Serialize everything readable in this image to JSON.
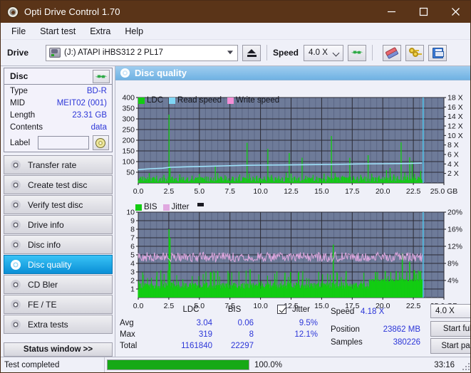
{
  "window": {
    "title": "Opti Drive Control 1.70",
    "icon": "disc-icon",
    "minimize": "minimize-icon",
    "maximize": "maximize-icon",
    "close": "close-icon"
  },
  "menu": {
    "items": [
      "File",
      "Start test",
      "Extra",
      "Help"
    ]
  },
  "toolbar": {
    "drive_label": "Drive",
    "drive_value": "(J:)  ATAPI iHBS312  2 PL17",
    "eject_icon": "eject-icon",
    "speed_label": "Speed",
    "speed_value": "4.0 X",
    "refresh_icon": "refresh-icon",
    "erase_icon": "eraser-icon",
    "keys_icon": "keys-icon",
    "save_icon": "floppy-save-icon"
  },
  "disc": {
    "title": "Disc",
    "refresh_icon": "refresh-icon",
    "rows": [
      {
        "key": "Type",
        "value": "BD-R"
      },
      {
        "key": "MID",
        "value": "MEIT02 (001)"
      },
      {
        "key": "Length",
        "value": "23.31 GB"
      },
      {
        "key": "Contents",
        "value": "data"
      }
    ],
    "label_key": "Label",
    "label_value": "",
    "label_placeholder": "",
    "cd_icon": "cd-icon"
  },
  "nav": {
    "items": [
      {
        "label": "Transfer rate",
        "icon": "disc-transfer-icon",
        "active": false
      },
      {
        "label": "Create test disc",
        "icon": "disc-create-icon",
        "active": false
      },
      {
        "label": "Verify test disc",
        "icon": "disc-verify-icon",
        "active": false
      },
      {
        "label": "Drive info",
        "icon": "disc-drive-icon",
        "active": false
      },
      {
        "label": "Disc info",
        "icon": "disc-info-icon",
        "active": false
      },
      {
        "label": "Disc quality",
        "icon": "disc-quality-icon",
        "active": true
      },
      {
        "label": "CD Bler",
        "icon": "disc-bler-icon",
        "active": false
      },
      {
        "label": "FE / TE",
        "icon": "disc-fete-icon",
        "active": false
      },
      {
        "label": "Extra tests",
        "icon": "disc-extra-icon",
        "active": false
      }
    ],
    "status_window": "Status window >>"
  },
  "panel": {
    "title": "Disc quality",
    "icon": "disc-quality-icon"
  },
  "chart_data": [
    {
      "type": "line",
      "name": "ldc-chart",
      "title": "",
      "xlabel": "GB",
      "ylabel": "",
      "xlim": [
        0,
        25
      ],
      "xticks": [
        "0.0",
        "2.5",
        "5.0",
        "7.5",
        "10.0",
        "12.5",
        "15.0",
        "17.5",
        "20.0",
        "22.5",
        "25.0 GB"
      ],
      "xtick_values": [
        0,
        2.5,
        5,
        7.5,
        10,
        12.5,
        15,
        17.5,
        20,
        22.5,
        25
      ],
      "ylim": [
        0,
        400
      ],
      "yticks": [
        "50",
        "100",
        "150",
        "200",
        "250",
        "300",
        "350",
        "400"
      ],
      "ytick_values": [
        50,
        100,
        150,
        200,
        250,
        300,
        350,
        400
      ],
      "y2lim": [
        0,
        18
      ],
      "y2ticks": [
        "2 X",
        "4 X",
        "6 X",
        "8 X",
        "10 X",
        "12 X",
        "14 X",
        "16 X",
        "18 X"
      ],
      "y2tick_values": [
        2,
        4,
        6,
        8,
        10,
        12,
        14,
        16,
        18
      ],
      "grid": true,
      "legend": [
        {
          "label": "LDC",
          "color": "#12cc12"
        },
        {
          "label": "Read speed",
          "color": "#7fd6f5"
        },
        {
          "label": "Write speed",
          "color": "#f58fd6"
        }
      ],
      "series": [
        {
          "name": "LDC",
          "color": "#12cc12",
          "style": "spikes",
          "baseline": 12,
          "spikes": [
            [
              0.35,
              30
            ],
            [
              0.6,
              22
            ],
            [
              0.9,
              46
            ],
            [
              1.2,
              26
            ],
            [
              1.5,
              34
            ],
            [
              1.8,
              20
            ],
            [
              2.1,
              38
            ],
            [
              2.52,
              320
            ],
            [
              2.6,
              72
            ],
            [
              2.8,
              30
            ],
            [
              3.1,
              24
            ],
            [
              3.4,
              40
            ],
            [
              3.7,
              28
            ],
            [
              4.0,
              22
            ],
            [
              4.4,
              34
            ],
            [
              4.7,
              26
            ],
            [
              5.0,
              42
            ],
            [
              5.3,
              24
            ],
            [
              5.6,
              30
            ],
            [
              5.9,
              20
            ],
            [
              6.3,
              78
            ],
            [
              6.5,
              46
            ],
            [
              6.8,
              26
            ],
            [
              7.1,
              36
            ],
            [
              7.4,
              22
            ],
            [
              7.7,
              30
            ],
            [
              8.0,
              24
            ],
            [
              8.3,
              40
            ],
            [
              8.6,
              28
            ],
            [
              8.9,
              188
            ],
            [
              9.1,
              44
            ],
            [
              9.4,
              26
            ],
            [
              9.7,
              34
            ],
            [
              10.0,
              22
            ],
            [
              10.3,
              30
            ],
            [
              10.6,
              160
            ],
            [
              10.9,
              38
            ],
            [
              11.2,
              26
            ],
            [
              11.5,
              32
            ],
            [
              11.8,
              24
            ],
            [
              12.1,
              48
            ],
            [
              12.35,
              140
            ],
            [
              12.5,
              44
            ],
            [
              12.8,
              30
            ],
            [
              13.1,
              24
            ],
            [
              13.4,
              118
            ],
            [
              13.7,
              34
            ],
            [
              14.0,
              26
            ],
            [
              14.3,
              38
            ],
            [
              14.6,
              30
            ],
            [
              14.9,
              22
            ],
            [
              15.2,
              44
            ],
            [
              15.5,
              34
            ],
            [
              15.8,
              220
            ],
            [
              16.1,
              46
            ],
            [
              16.4,
              28
            ],
            [
              16.7,
              34
            ],
            [
              17.0,
              24
            ],
            [
              17.3,
              118
            ],
            [
              17.6,
              32
            ],
            [
              17.9,
              26
            ],
            [
              18.2,
              38
            ],
            [
              18.5,
              30
            ],
            [
              18.8,
              130
            ],
            [
              19.1,
              44
            ],
            [
              19.4,
              26
            ],
            [
              19.7,
              34
            ],
            [
              20.0,
              28
            ],
            [
              20.3,
              60
            ],
            [
              20.6,
              70
            ],
            [
              20.9,
              40
            ],
            [
              21.2,
              32
            ],
            [
              21.5,
              190
            ],
            [
              21.8,
              48
            ],
            [
              22.0,
              36
            ],
            [
              22.2,
              120
            ],
            [
              22.4,
              100
            ],
            [
              22.6,
              42
            ],
            [
              22.9,
              30
            ],
            [
              23.1,
              56
            ]
          ]
        },
        {
          "name": "Read speed",
          "color": "#7fd6f5",
          "style": "line",
          "axis": "y2",
          "points": [
            [
              0.0,
              2.8
            ],
            [
              1.0,
              3.0
            ],
            [
              2.0,
              3.1
            ],
            [
              2.6,
              3.3
            ],
            [
              4.0,
              3.4
            ],
            [
              5.5,
              3.5
            ],
            [
              7.0,
              3.6
            ],
            [
              8.5,
              3.7
            ],
            [
              10.0,
              3.75
            ],
            [
              12.0,
              3.8
            ],
            [
              14.0,
              3.85
            ],
            [
              16.0,
              3.9
            ],
            [
              18.0,
              4.0
            ],
            [
              20.0,
              4.05
            ],
            [
              22.0,
              4.1
            ],
            [
              23.2,
              4.18
            ]
          ]
        },
        {
          "name": "Write speed",
          "color": "#f58fd6",
          "style": "line",
          "points": []
        }
      ],
      "cursor": {
        "x": 23.3,
        "color": "#4ec8f0"
      }
    },
    {
      "type": "line",
      "name": "bis-jitter-chart",
      "title": "",
      "xlabel": "GB",
      "xlim": [
        0,
        25
      ],
      "xticks": [
        "0.0",
        "2.5",
        "5.0",
        "7.5",
        "10.0",
        "12.5",
        "15.0",
        "17.5",
        "20.0",
        "22.5",
        "25.0 GB"
      ],
      "xtick_values": [
        0,
        2.5,
        5,
        7.5,
        10,
        12.5,
        15,
        17.5,
        20,
        22.5,
        25
      ],
      "ylim": [
        0,
        10
      ],
      "yticks": [
        "1",
        "2",
        "3",
        "4",
        "5",
        "6",
        "7",
        "8",
        "9",
        "10"
      ],
      "ytick_values": [
        1,
        2,
        3,
        4,
        5,
        6,
        7,
        8,
        9,
        10
      ],
      "y2lim": [
        0,
        20
      ],
      "y2ticks": [
        "4%",
        "8%",
        "12%",
        "16%",
        "20%"
      ],
      "y2tick_values": [
        4,
        8,
        12,
        16,
        20
      ],
      "grid": true,
      "legend": [
        {
          "label": "BIS",
          "color": "#12cc12"
        },
        {
          "label": "Jitter",
          "color": "#e0a8e0"
        }
      ],
      "series": [
        {
          "name": "BIS",
          "color": "#12cc12",
          "style": "spikes",
          "baseline": 1.0,
          "mean": 0.06,
          "max": 8
        },
        {
          "name": "Jitter",
          "color": "#e0a8e0",
          "style": "noisy-line",
          "axis": "y2",
          "mean": 9.5,
          "max": 12.1,
          "amplitude": 1.1
        }
      ],
      "cursor": {
        "x": 23.3,
        "color": "#4ec8f0"
      }
    }
  ],
  "stats": {
    "col_headers": [
      "LDC",
      "BIS"
    ],
    "rows": [
      {
        "label": "Avg",
        "ldc": "3.04",
        "bis": "0.06",
        "jitter": "9.5%"
      },
      {
        "label": "Max",
        "ldc": "319",
        "bis": "8",
        "jitter": "12.1%"
      },
      {
        "label": "Total",
        "ldc": "1161840",
        "bis": "22297",
        "jitter": ""
      }
    ],
    "jitter_label": "Jitter",
    "jitter_checked": true,
    "speed_label": "Speed",
    "speed_value": "4.18 X",
    "position_label": "Position",
    "position_value": "23862 MB",
    "samples_label": "Samples",
    "samples_value": "380226",
    "speed_select": "4.0 X",
    "start_full": "Start full",
    "start_part": "Start part"
  },
  "statusbar": {
    "message": "Test completed",
    "progress_pct": "100.0%",
    "progress_value": 100,
    "elapsed": "33:16"
  },
  "colors": {
    "titlebar": "#5a3418",
    "accent": "#2c36d8",
    "plot_bg": "#6e7b99",
    "green": "#12cc12",
    "cyan": "#7fd6f5",
    "pink": "#e0a8e0",
    "progress": "#16a916"
  }
}
